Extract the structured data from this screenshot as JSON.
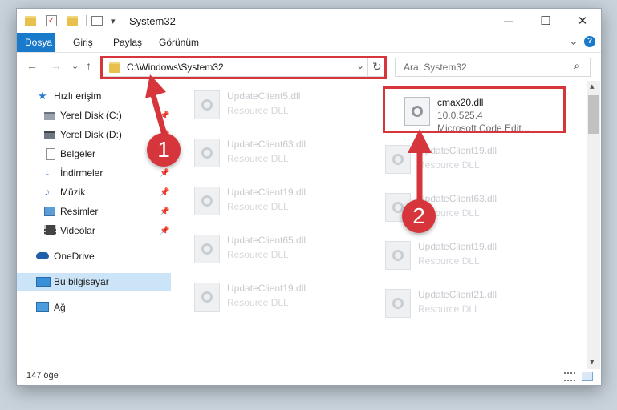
{
  "window": {
    "title": "System32",
    "qat": {
      "dropdown_glyph": "▾"
    },
    "controls": {
      "minimize": "—",
      "maximize": "☐",
      "close": "✕"
    }
  },
  "ribbon": {
    "tabs": [
      {
        "label": "Dosya",
        "active": true
      },
      {
        "label": "Giriş"
      },
      {
        "label": "Paylaş"
      },
      {
        "label": "Görünüm"
      }
    ],
    "expand_glyph": "⌄",
    "help_glyph": "?"
  },
  "nav": {
    "back": "←",
    "forward": "→",
    "recent": "⌄",
    "up": "↑",
    "address": "C:\\Windows\\System32",
    "address_dropdown": "⌄",
    "refresh": "↻",
    "search_placeholder": "Ara: System32",
    "search_icon": "⌕"
  },
  "sidebar": {
    "items": [
      {
        "label": "Hızlı erişim",
        "icon": "star-icon",
        "pinned": false
      },
      {
        "label": "Yerel Disk (C:)",
        "icon": "drive-icon",
        "pinned": true
      },
      {
        "label": "Yerel Disk (D:)",
        "icon": "drive-icon",
        "pinned": true
      },
      {
        "label": "Belgeler",
        "icon": "documents-icon",
        "pinned": true
      },
      {
        "label": "İndirmeler",
        "icon": "download-icon",
        "pinned": true
      },
      {
        "label": "Müzik",
        "icon": "music-icon",
        "pinned": true
      },
      {
        "label": "Resimler",
        "icon": "pictures-icon",
        "pinned": true
      },
      {
        "label": "Videolar",
        "icon": "videos-icon",
        "pinned": true
      },
      {
        "label": "OneDrive",
        "icon": "cloud-icon",
        "pinned": false
      },
      {
        "label": "Bu bilgisayar",
        "icon": "computer-icon",
        "pinned": false,
        "selected": true
      },
      {
        "label": "Ağ",
        "icon": "network-icon",
        "pinned": false
      }
    ],
    "pin_glyph": "📌"
  },
  "files": {
    "left_column": [
      {
        "name": "UpdateClient5.dll",
        "desc": "Resource DLL"
      },
      {
        "name": "UpdateClient63.dll",
        "desc": "Resource DLL"
      },
      {
        "name": "UpdateClient19.dll",
        "desc": "Resource DLL"
      },
      {
        "name": "UpdateClient65.dll",
        "desc": "Resource DLL"
      },
      {
        "name": "UpdateClient19.dll",
        "desc": "Resource DLL"
      }
    ],
    "right_column": [
      {
        "name": "cmax20.dll",
        "desc": "10.0.525.4",
        "desc2": "Microsoft Code Edit...",
        "focused": true
      },
      {
        "name": "UpdateClient19.dll",
        "desc": "Resource DLL"
      },
      {
        "name": "UpdateClient63.dll",
        "desc": "Resource DLL"
      },
      {
        "name": "UpdateClient19.dll",
        "desc": "Resource DLL"
      },
      {
        "name": "UpdateClient21.dll",
        "desc": "Resource DLL"
      }
    ]
  },
  "annotations": {
    "step1": "1",
    "step2": "2"
  },
  "status": {
    "count": "147 öğe"
  },
  "scrollbar": {
    "up": "▴",
    "down": "▾"
  },
  "colors": {
    "accent": "#1979ca",
    "highlight_red": "#d6353b",
    "selection": "#cce4f7"
  }
}
